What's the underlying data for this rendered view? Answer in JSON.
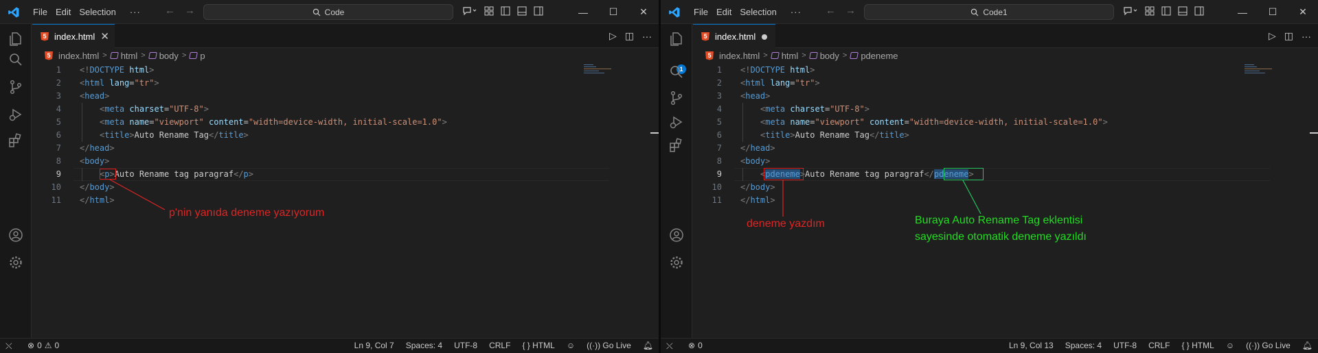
{
  "windows": [
    {
      "menu": [
        "File",
        "Edit",
        "Selection"
      ],
      "search": "Code",
      "tab": {
        "label": "index.html",
        "modified": false
      },
      "breadcrumb": [
        "index.html",
        "html",
        "body",
        "p"
      ],
      "lines": [
        {
          "n": "1",
          "indent": 0,
          "tokens": [
            [
              "brk",
              "<!"
            ],
            [
              "tag",
              "DOCTYPE"
            ],
            [
              "txt",
              " "
            ],
            [
              "attr",
              "html"
            ],
            [
              "brk",
              ">"
            ]
          ]
        },
        {
          "n": "2",
          "indent": 0,
          "tokens": [
            [
              "brk",
              "<"
            ],
            [
              "tag",
              "html"
            ],
            [
              "txt",
              " "
            ],
            [
              "attr",
              "lang"
            ],
            [
              "txt",
              "="
            ],
            [
              "str",
              "\"tr\""
            ],
            [
              "brk",
              ">"
            ]
          ]
        },
        {
          "n": "3",
          "indent": 0,
          "tokens": [
            [
              "brk",
              "<"
            ],
            [
              "tag",
              "head"
            ],
            [
              "brk",
              ">"
            ]
          ]
        },
        {
          "n": "4",
          "indent": 1,
          "tokens": [
            [
              "brk",
              "<"
            ],
            [
              "tag",
              "meta"
            ],
            [
              "txt",
              " "
            ],
            [
              "attr",
              "charset"
            ],
            [
              "txt",
              "="
            ],
            [
              "str",
              "\"UTF-8\""
            ],
            [
              "brk",
              ">"
            ]
          ]
        },
        {
          "n": "5",
          "indent": 1,
          "tokens": [
            [
              "brk",
              "<"
            ],
            [
              "tag",
              "meta"
            ],
            [
              "txt",
              " "
            ],
            [
              "attr",
              "name"
            ],
            [
              "txt",
              "="
            ],
            [
              "str",
              "\"viewport\""
            ],
            [
              "txt",
              " "
            ],
            [
              "attr",
              "content"
            ],
            [
              "txt",
              "="
            ],
            [
              "str",
              "\"width=device-width, initial-scale=1.0\""
            ],
            [
              "brk",
              ">"
            ]
          ]
        },
        {
          "n": "6",
          "indent": 1,
          "tokens": [
            [
              "brk",
              "<"
            ],
            [
              "tag",
              "title"
            ],
            [
              "brk",
              ">"
            ],
            [
              "txt",
              "Auto Rename Tag"
            ],
            [
              "brk",
              "</"
            ],
            [
              "tag",
              "title"
            ],
            [
              "brk",
              ">"
            ]
          ]
        },
        {
          "n": "7",
          "indent": 0,
          "tokens": [
            [
              "brk",
              "</"
            ],
            [
              "tag",
              "head"
            ],
            [
              "brk",
              ">"
            ]
          ]
        },
        {
          "n": "8",
          "indent": 0,
          "tokens": [
            [
              "brk",
              "<"
            ],
            [
              "tag",
              "body"
            ],
            [
              "brk",
              ">"
            ]
          ]
        },
        {
          "n": "9",
          "indent": 1,
          "tokens": [
            [
              "brk",
              "<"
            ],
            [
              "tag",
              "p"
            ],
            [
              "brk",
              ">"
            ],
            [
              "txt",
              "Auto Rename tag paragraf"
            ],
            [
              "brk",
              "</"
            ],
            [
              "tag",
              "p"
            ],
            [
              "brk",
              ">"
            ]
          ]
        },
        {
          "n": "10",
          "indent": 0,
          "tokens": [
            [
              "brk",
              "</"
            ],
            [
              "tag",
              "body"
            ],
            [
              "brk",
              ">"
            ]
          ]
        },
        {
          "n": "11",
          "indent": 0,
          "tokens": [
            [
              "brk",
              "</"
            ],
            [
              "tag",
              "html"
            ],
            [
              "brk",
              ">"
            ]
          ]
        }
      ],
      "annotations": [
        {
          "text": "p'nin yanıda deneme yazıyorum",
          "color": "red"
        }
      ],
      "status": {
        "errors": "0",
        "warnings": "0",
        "position": "Ln 9, Col 7",
        "spaces": "Spaces: 4",
        "encoding": "UTF-8",
        "eol": "CRLF",
        "language": "HTML",
        "golive": "Go Live"
      }
    },
    {
      "menu": [
        "File",
        "Edit",
        "Selection"
      ],
      "search": "Code1",
      "tab": {
        "label": "index.html",
        "modified": true
      },
      "breadcrumb": [
        "index.html",
        "html",
        "body",
        "pdeneme"
      ],
      "lines": [
        {
          "n": "1",
          "indent": 0,
          "tokens": [
            [
              "brk",
              "<!"
            ],
            [
              "tag",
              "DOCTYPE"
            ],
            [
              "txt",
              " "
            ],
            [
              "attr",
              "html"
            ],
            [
              "brk",
              ">"
            ]
          ]
        },
        {
          "n": "2",
          "indent": 0,
          "tokens": [
            [
              "brk",
              "<"
            ],
            [
              "tag",
              "html"
            ],
            [
              "txt",
              " "
            ],
            [
              "attr",
              "lang"
            ],
            [
              "txt",
              "="
            ],
            [
              "str",
              "\"tr\""
            ],
            [
              "brk",
              ">"
            ]
          ]
        },
        {
          "n": "3",
          "indent": 0,
          "tokens": [
            [
              "brk",
              "<"
            ],
            [
              "tag",
              "head"
            ],
            [
              "brk",
              ">"
            ]
          ]
        },
        {
          "n": "4",
          "indent": 1,
          "tokens": [
            [
              "brk",
              "<"
            ],
            [
              "tag",
              "meta"
            ],
            [
              "txt",
              " "
            ],
            [
              "attr",
              "charset"
            ],
            [
              "txt",
              "="
            ],
            [
              "str",
              "\"UTF-8\""
            ],
            [
              "brk",
              ">"
            ]
          ]
        },
        {
          "n": "5",
          "indent": 1,
          "tokens": [
            [
              "brk",
              "<"
            ],
            [
              "tag",
              "meta"
            ],
            [
              "txt",
              " "
            ],
            [
              "attr",
              "name"
            ],
            [
              "txt",
              "="
            ],
            [
              "str",
              "\"viewport\""
            ],
            [
              "txt",
              " "
            ],
            [
              "attr",
              "content"
            ],
            [
              "txt",
              "="
            ],
            [
              "str",
              "\"width=device-width, initial-scale=1.0\""
            ],
            [
              "brk",
              ">"
            ]
          ]
        },
        {
          "n": "6",
          "indent": 1,
          "tokens": [
            [
              "brk",
              "<"
            ],
            [
              "tag",
              "title"
            ],
            [
              "brk",
              ">"
            ],
            [
              "txt",
              "Auto Rename Tag"
            ],
            [
              "brk",
              "</"
            ],
            [
              "tag",
              "title"
            ],
            [
              "brk",
              ">"
            ]
          ]
        },
        {
          "n": "7",
          "indent": 0,
          "tokens": [
            [
              "brk",
              "</"
            ],
            [
              "tag",
              "head"
            ],
            [
              "brk",
              ">"
            ]
          ]
        },
        {
          "n": "8",
          "indent": 0,
          "tokens": [
            [
              "brk",
              "<"
            ],
            [
              "tag",
              "body"
            ],
            [
              "brk",
              ">"
            ]
          ]
        },
        {
          "n": "9",
          "indent": 1,
          "tokens": [
            [
              "brk",
              "<"
            ],
            [
              "tagHL",
              "pdeneme"
            ],
            [
              "brk",
              ">"
            ],
            [
              "txt",
              "Auto Rename tag paragraf"
            ],
            [
              "brk",
              "</"
            ],
            [
              "tagHL",
              "pdeneme"
            ],
            [
              "brk",
              ">"
            ]
          ]
        },
        {
          "n": "10",
          "indent": 0,
          "tokens": [
            [
              "brk",
              "</"
            ],
            [
              "tag",
              "body"
            ],
            [
              "brk",
              ">"
            ]
          ]
        },
        {
          "n": "11",
          "indent": 0,
          "tokens": [
            [
              "brk",
              "</"
            ],
            [
              "tag",
              "html"
            ],
            [
              "brk",
              ">"
            ]
          ]
        }
      ],
      "annotations": [
        {
          "text": "deneme yazdım",
          "color": "red"
        },
        {
          "text": "Buraya Auto Rename Tag eklentisi",
          "color": "green"
        },
        {
          "text": "sayesinde otomatik deneme yazıldı",
          "color": "green"
        }
      ],
      "status": {
        "errors": "0",
        "warnings": "",
        "position": "Ln 9, Col 13",
        "spaces": "Spaces: 4",
        "encoding": "UTF-8",
        "eol": "CRLF",
        "language": "HTML",
        "golive": "Go Live"
      }
    }
  ],
  "explorer_badge": "1",
  "colors": {
    "accent": "#0078d4",
    "annotation_red": "#e02424",
    "annotation_green": "#22dd22"
  }
}
